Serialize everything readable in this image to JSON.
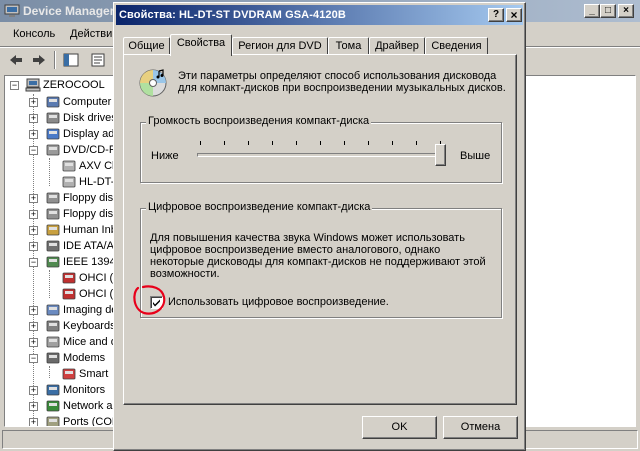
{
  "device_manager": {
    "title": "Device Manager",
    "menu": [
      "Консоль",
      "Действи"
    ],
    "tree": {
      "root": "ZEROCOOL",
      "items": [
        {
          "label": "Computer",
          "expanded": false
        },
        {
          "label": "Disk drives",
          "expanded": false
        },
        {
          "label": "Display ad",
          "expanded": false
        },
        {
          "label": "DVD/CD-R",
          "expanded": true
        },
        {
          "label": "AXV Cl",
          "child": true
        },
        {
          "label": "HL-DT-",
          "child": true
        },
        {
          "label": "Floppy disl",
          "expanded": false
        },
        {
          "label": "Floppy disl",
          "expanded": false
        },
        {
          "label": "Human Inb",
          "expanded": false
        },
        {
          "label": "IDE ATA/A",
          "expanded": false
        },
        {
          "label": "IEEE 1394",
          "expanded": true
        },
        {
          "label": "OHCI (",
          "child": true
        },
        {
          "label": "OHCI (",
          "child": true
        },
        {
          "label": "Imaging de",
          "expanded": false
        },
        {
          "label": "Keyboards",
          "expanded": false
        },
        {
          "label": "Mice and o",
          "expanded": false
        },
        {
          "label": "Modems",
          "expanded": true
        },
        {
          "label": "Smart",
          "child": true
        },
        {
          "label": "Monitors",
          "expanded": false
        },
        {
          "label": "Network a",
          "expanded": false
        },
        {
          "label": "Ports (COM",
          "expanded": false
        }
      ]
    }
  },
  "dialog": {
    "title": "Свойства: HL-DT-ST DVDRAM GSA-4120B",
    "help_btn": "?",
    "close_btn": "×",
    "tabs": [
      "Общие",
      "Свойства",
      "Регион для DVD",
      "Тома",
      "Драйвер",
      "Сведения"
    ],
    "active_tab": 1,
    "description": "Эти параметры определяют способ использования дисковода для компакт-дисков при воспроизведении музыкальных дисков.",
    "volume_group": {
      "label": "Громкость воспроизведения компакт-диска",
      "low": "Ниже",
      "high": "Выше",
      "value": 1.0
    },
    "digital_group": {
      "label": "Цифровое воспроизведение компакт-диска",
      "text": "Для повышения качества звука Windows может использовать цифровое воспроизведение вместо аналогового, однако некоторые дисководы для компакт-дисков не поддерживают этой возможности.",
      "checkbox_label": "Использовать цифровое воспроизведение.",
      "checked": true
    },
    "ok": "OK",
    "cancel": "Отмена"
  },
  "colors": {
    "annotation": "#e8001a",
    "active_title": "#0a246a"
  }
}
